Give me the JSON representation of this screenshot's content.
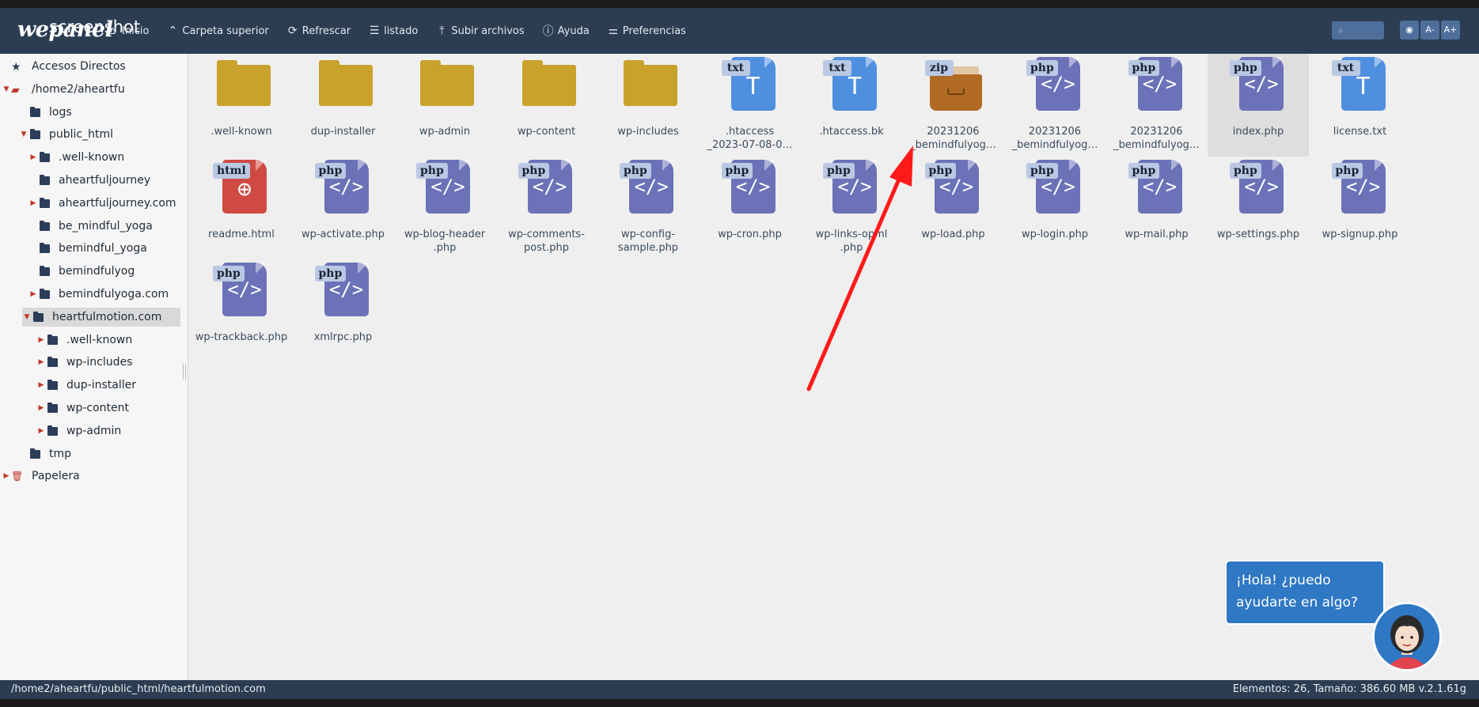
{
  "window": {
    "overlay_label": "screenshot"
  },
  "brand": {
    "logo": "wepanel"
  },
  "toolbar": {
    "items": [
      {
        "label": "Inicio",
        "icon": "home-icon"
      },
      {
        "label": "Carpeta superior",
        "icon": "chevron-up-icon"
      },
      {
        "label": "Refrescar",
        "icon": "refresh-icon"
      },
      {
        "label": "listado",
        "icon": "list-icon"
      },
      {
        "label": "Subir archivos",
        "icon": "upload-icon"
      },
      {
        "label": "Ayuda",
        "icon": "help-icon"
      },
      {
        "label": "Preferencias",
        "icon": "sliders-icon"
      }
    ],
    "font_decrease": "A-",
    "font_increase": "A+"
  },
  "sidebar": {
    "items": [
      {
        "label": "Accesos Directos",
        "icon": "star-icon",
        "level": 0,
        "arrow": ""
      },
      {
        "label": "/home2/aheartfu",
        "icon": "drive-icon",
        "level": 0,
        "arrow": "down"
      },
      {
        "label": "logs",
        "icon": "folder-icon",
        "level": 1,
        "arrow": ""
      },
      {
        "label": "public_html",
        "icon": "folder-icon",
        "level": 1,
        "arrow": "down"
      },
      {
        "label": ".well-known",
        "icon": "folder-icon",
        "level": 2,
        "arrow": "right"
      },
      {
        "label": "aheartfuljourney",
        "icon": "folder-icon",
        "level": 2,
        "arrow": ""
      },
      {
        "label": "aheartfuljourney.com",
        "icon": "folder-icon",
        "level": 2,
        "arrow": "right"
      },
      {
        "label": "be_mindful_yoga",
        "icon": "folder-icon",
        "level": 2,
        "arrow": ""
      },
      {
        "label": "bemindful_yoga",
        "icon": "folder-icon",
        "level": 2,
        "arrow": ""
      },
      {
        "label": "bemindfulyog",
        "icon": "folder-icon",
        "level": 2,
        "arrow": ""
      },
      {
        "label": "bemindfulyoga.com",
        "icon": "folder-icon",
        "level": 2,
        "arrow": "right"
      },
      {
        "label": "heartfulmotion.com",
        "icon": "folder-open-icon",
        "level": 2,
        "arrow": "down",
        "selected": true
      },
      {
        "label": ".well-known",
        "icon": "folder-icon",
        "level": 3,
        "arrow": "right"
      },
      {
        "label": "wp-includes",
        "icon": "folder-icon",
        "level": 3,
        "arrow": "right"
      },
      {
        "label": "dup-installer",
        "icon": "folder-icon",
        "level": 3,
        "arrow": "right"
      },
      {
        "label": "wp-content",
        "icon": "folder-icon",
        "level": 3,
        "arrow": "right"
      },
      {
        "label": "wp-admin",
        "icon": "folder-icon",
        "level": 3,
        "arrow": "right"
      },
      {
        "label": "tmp",
        "icon": "folder-icon",
        "level": 1,
        "arrow": ""
      },
      {
        "label": "Papelera",
        "icon": "trash-icon",
        "level": 0,
        "arrow": "right"
      }
    ]
  },
  "files": [
    {
      "name": ".well-known",
      "type": "folder"
    },
    {
      "name": "dup-installer",
      "type": "folder"
    },
    {
      "name": "wp-admin",
      "type": "folder"
    },
    {
      "name": "wp-content",
      "type": "folder"
    },
    {
      "name": "wp-includes",
      "type": "folder"
    },
    {
      "name": ".htaccess\n_2023-07-08-0…",
      "type": "txt",
      "badge": "txt"
    },
    {
      "name": ".htaccess.bk",
      "type": "txt",
      "badge": "txt"
    },
    {
      "name": "20231206\n_bemindfulyog…",
      "type": "zip",
      "badge": "zip"
    },
    {
      "name": "20231206\n_bemindfulyog…",
      "type": "php",
      "badge": "php"
    },
    {
      "name": "20231206\n_bemindfulyog…",
      "type": "php",
      "badge": "php"
    },
    {
      "name": "index.php",
      "type": "php",
      "badge": "php",
      "hover": true
    },
    {
      "name": "license.txt",
      "type": "txt",
      "badge": "txt"
    },
    {
      "name": "readme.html",
      "type": "html",
      "badge": "html"
    },
    {
      "name": "wp-activate.php",
      "type": "php",
      "badge": "php"
    },
    {
      "name": "wp-blog-header\n.php",
      "type": "php",
      "badge": "php"
    },
    {
      "name": "wp-comments-\npost.php",
      "type": "php",
      "badge": "php"
    },
    {
      "name": "wp-config-\nsample.php",
      "type": "php",
      "badge": "php"
    },
    {
      "name": "wp-cron.php",
      "type": "php",
      "badge": "php"
    },
    {
      "name": "wp-links-opml\n.php",
      "type": "php",
      "badge": "php"
    },
    {
      "name": "wp-load.php",
      "type": "php",
      "badge": "php"
    },
    {
      "name": "wp-login.php",
      "type": "php",
      "badge": "php"
    },
    {
      "name": "wp-mail.php",
      "type": "php",
      "badge": "php"
    },
    {
      "name": "wp-settings.php",
      "type": "php",
      "badge": "php"
    },
    {
      "name": "wp-signup.php",
      "type": "php",
      "badge": "php"
    },
    {
      "name": "wp-trackback.php",
      "type": "php",
      "badge": "php"
    },
    {
      "name": "xmlrpc.php",
      "type": "php",
      "badge": "php"
    }
  ],
  "status": {
    "path": "/home2/aheartfu/public_html/heartfulmotion.com",
    "info": "Elementos: 26, Tamaño: 386.60 MB v.2.1.61g"
  },
  "chat": {
    "message": "¡Hola! ¿puedo ayudarte en algo?"
  },
  "colors": {
    "toolbar_bg": "#2c3d52",
    "folder": "#c9a22c",
    "php": "#6b72b8",
    "txt": "#4f8fe0",
    "html": "#cf4a43",
    "zip": "#b16a22",
    "annotation_arrow": "#ff0000"
  }
}
